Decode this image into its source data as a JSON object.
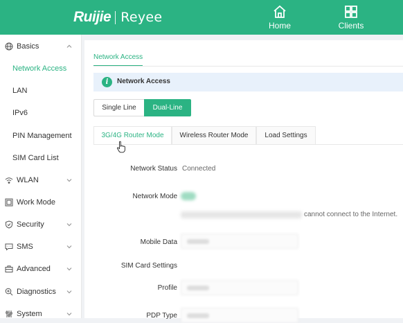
{
  "brand": {
    "name_left": "Ruijie",
    "name_right": "Reyee"
  },
  "topnav": {
    "home_label": "Home",
    "clients_label": "Clients"
  },
  "sidebar": {
    "items": [
      {
        "label": "Basics",
        "icon": "globe-icon",
        "expanded": true
      },
      {
        "label": "Network Access",
        "sub": true,
        "active": true
      },
      {
        "label": "LAN",
        "sub": true
      },
      {
        "label": "IPv6",
        "sub": true
      },
      {
        "label": "PIN Management",
        "sub": true
      },
      {
        "label": "SIM Card List",
        "sub": true
      },
      {
        "label": "WLAN",
        "icon": "wifi-icon"
      },
      {
        "label": "Work Mode",
        "icon": "work-mode-icon"
      },
      {
        "label": "Security",
        "icon": "shield-icon"
      },
      {
        "label": "SMS",
        "icon": "message-icon"
      },
      {
        "label": "Advanced",
        "icon": "briefcase-icon"
      },
      {
        "label": "Diagnostics",
        "icon": "magnifier-icon"
      },
      {
        "label": "System",
        "icon": "sliders-icon"
      }
    ]
  },
  "main": {
    "page_tab": "Network Access",
    "info_title": "Network Access",
    "line_modes": [
      "Single Line",
      "Dual-Line"
    ],
    "mode_tabs": [
      "3G/4G Router Mode",
      "Wireless Router Mode",
      "Load Settings"
    ],
    "fields": {
      "network_status_label": "Network Status",
      "network_status_value": "Connected",
      "network_mode_label": "Network Mode",
      "network_mode_note": "cannot connect to the Internet.",
      "mobile_data_label": "Mobile Data",
      "sim_settings_label": "SIM Card Settings",
      "profile_label": "Profile",
      "pdp_type_label": "PDP Type"
    }
  },
  "colors": {
    "accent": "#2bb383",
    "info_bg": "#e8f1fb"
  }
}
